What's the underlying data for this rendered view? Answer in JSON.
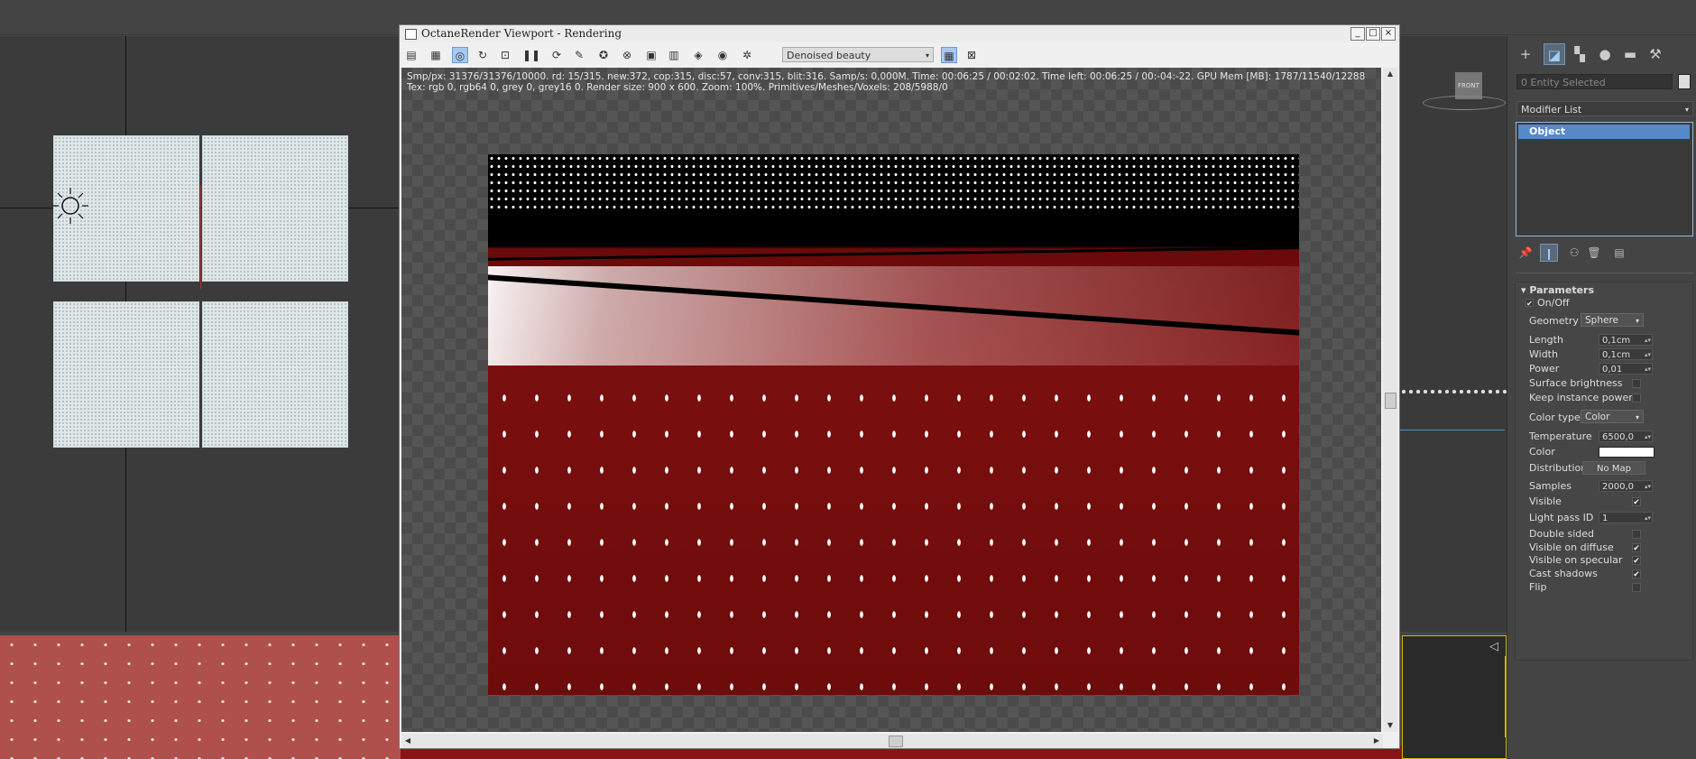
{
  "octane_window": {
    "title": "OctaneRender Viewport - Rendering",
    "window_buttons": {
      "minimize": "_",
      "maximize": "□",
      "close": "×"
    },
    "render_pass": "Denoised beauty",
    "stats_line1": "Smp/px: 31376/31376/10000.   rd: 15/315.   new:372, cop:315, disc:57, conv:315, blit:316.   Samp/s: 0,000M.   Time: 00:06:25 / 00:02:02.   Time left: 00:06:25 / 00:-04:-22.   GPU Mem [MB]: 1787/11540/12288",
    "stats_line2": "Tex: rgb 0, rgb64 0, grey 0, grey16 0.   Render size: 900 x 600.   Zoom: 100%.   Primitives/Meshes/Voxels: 208/5988/0"
  },
  "viewport_right": {
    "viewcube_label": "FRONT"
  },
  "command_panel": {
    "entity_selected": "0 Entity Selected",
    "modifier_list": "Modifier List",
    "stack_item": "Object",
    "rollout_title": "Parameters",
    "onoff": {
      "label": "On/Off",
      "checked": true
    },
    "geometry": {
      "label": "Geometry",
      "value": "Sphere"
    },
    "length": {
      "label": "Length",
      "value": "0,1cm"
    },
    "width": {
      "label": "Width",
      "value": "0,1cm"
    },
    "power": {
      "label": "Power",
      "value": "0,01"
    },
    "surface_brightness": {
      "label": "Surface brightness",
      "checked": false
    },
    "keep_instance_power": {
      "label": "Keep instance power",
      "checked": false
    },
    "color_type": {
      "label": "Color type",
      "value": "Color"
    },
    "temperature": {
      "label": "Temperature",
      "value": "6500,0"
    },
    "color": {
      "label": "Color",
      "value": "#ffffff"
    },
    "distribution": {
      "label": "Distribution",
      "value": "No Map"
    },
    "samples": {
      "label": "Samples",
      "value": "2000,0"
    },
    "visible": {
      "label": "Visible",
      "checked": true
    },
    "light_pass_id": {
      "label": "Light pass ID",
      "value": "1"
    },
    "double_sided": {
      "label": "Double sided",
      "checked": false
    },
    "visible_on_diffuse": {
      "label": "Visible on diffuse",
      "checked": true
    },
    "visible_on_specular": {
      "label": "Visible on specular",
      "checked": true
    },
    "cast_shadows": {
      "label": "Cast shadows",
      "checked": true
    },
    "flip": {
      "label": "Flip",
      "checked": false
    }
  },
  "icons": {
    "check": "✔",
    "arrow_down": "▾",
    "spin": "▴▾"
  }
}
